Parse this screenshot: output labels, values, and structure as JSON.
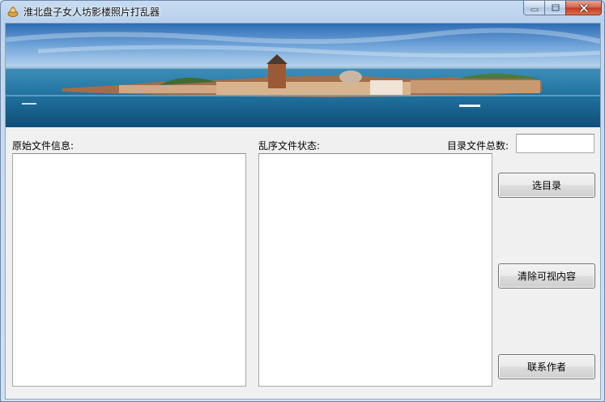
{
  "window": {
    "title": "淮北盘子女人坊影楼照片打乱器",
    "icon": "pot-icon"
  },
  "caption_buttons": {
    "minimize": "minimize-icon",
    "maximize": "maximize-icon",
    "close": "close-icon"
  },
  "banner": {
    "description_icon": "venice-island-banner"
  },
  "left_panel": {
    "label": "原始文件信息:",
    "value": ""
  },
  "middle_panel": {
    "label": "乱序文件状态:",
    "value": ""
  },
  "file_count": {
    "label": "目录文件总数:",
    "value": ""
  },
  "buttons": {
    "select_dir": "选目录",
    "clear": "清除可视内容",
    "contact": "联系作者"
  }
}
